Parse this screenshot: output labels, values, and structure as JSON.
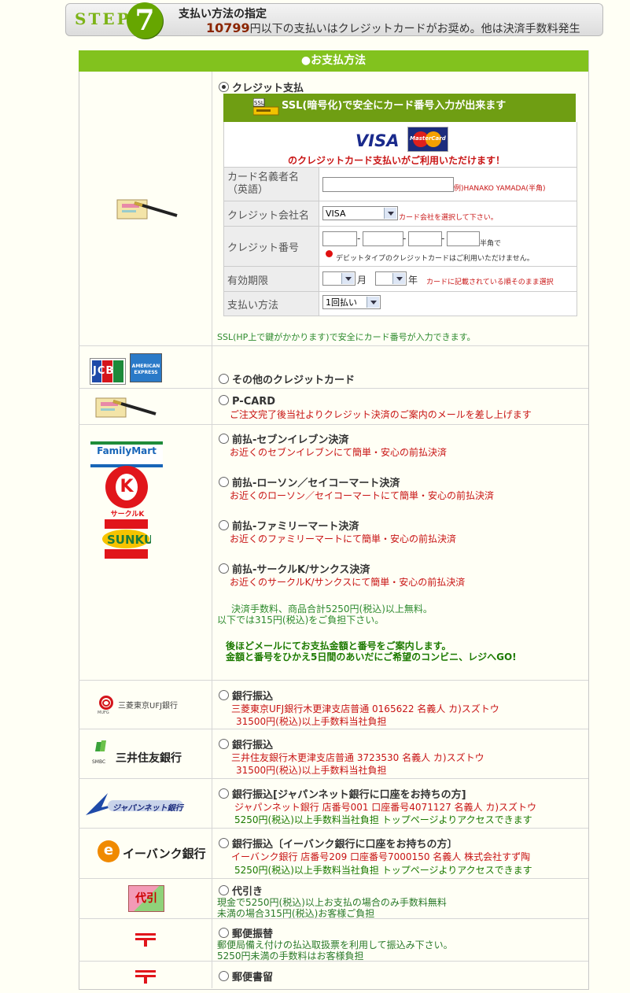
{
  "header": {
    "step_word": "STEP",
    "step_number": "7",
    "title": "支払い方法の指定",
    "threshold_amount": "10799",
    "subtitle": "円以下の支払いはクレジットカードがお奨め。他は決済手数料発生"
  },
  "table": {
    "heading": "●お支払方法"
  },
  "credit": {
    "option_label": "クレジット支払",
    "ssl_banner": "SSL(暗号化)で安全にカード番号入力が出来ます",
    "ssl_icon_text": "SSL",
    "visa_text": "VISA",
    "mastercard_text": "MasterCard",
    "cards_note": "のクレジットカード支払いがご利用いただけます！",
    "form": {
      "holder_label": "カード名義者名（英語）",
      "holder_hint": "例)HANAKO YAMADA(半角)",
      "company_label": "クレジット会社名",
      "company_value": "VISA",
      "company_hint": "カード会社を選択して下さい。",
      "number_label": "クレジット番号",
      "number_hint": "半角で",
      "debit_note": "デビットタイプのクレジットカードはご利用いただけません。",
      "expiry_label": "有効期限",
      "month_unit": "月",
      "year_unit": "年",
      "expiry_hint": "カードに記載されている順そのまま選択",
      "method_label": "支払い方法",
      "method_value": "1回払い"
    },
    "ssl_footer": "SSL(HP上で鍵がかかります)で安全にカード番号が入力できます。"
  },
  "other_credit": {
    "option_label": "その他のクレジットカード",
    "jcb_text": "JCB",
    "amex_text": "AMERICAN EXPRESS"
  },
  "pcard": {
    "option_label": "P-CARD",
    "note": "ご注文完了後当社よりクレジット決済のご案内のメールを差し上げます"
  },
  "convenience": {
    "familymart_logo": "FamilyMart",
    "circlek_logo": "サークルK",
    "options": [
      {
        "label": "前払-セブンイレブン決済",
        "note": "お近くのセブンイレブンにて簡単・安心の前払決済"
      },
      {
        "label": "前払-ローソン／セイコーマート決済",
        "note": "お近くのローソン／セイコーマートにて簡単・安心の前払決済"
      },
      {
        "label": "前払-ファミリーマート決済",
        "note": "お近くのファミリーマートにて簡単・安心の前払決済"
      },
      {
        "label": "前払-サークルK/サンクス決済",
        "note": "お近くのサークルK/サンクスにて簡単・安心の前払決済"
      }
    ],
    "fee_line1": "決済手数料、商品合計5250円(税込)以上無料。",
    "fee_line2": "以下では315円(税込)をご負担下さい。",
    "guide_line1": "後ほどメールにてお支払金額と番号をご案内します。",
    "guide_line2": "金額と番号をひかえ5日間のあいだにご希望のコンビニ、レジへGO!"
  },
  "banks": [
    {
      "logo": "三菱東京UFJ銀行",
      "logo_sub": "MUFG",
      "option_label": "銀行振込",
      "line1": "三菱東京UFJ銀行木更津支店普通  0165622 名義人 カ)スズトウ",
      "line2": "31500円(税込)以上手数料当社負担"
    },
    {
      "logo": "三井住友銀行",
      "logo_sub": "SMBC",
      "option_label": "銀行振込",
      "line1": "三井住友銀行木更津支店普通  3723530 名義人 カ)スズトウ",
      "line2": "31500円(税込)以上手数料当社負担"
    },
    {
      "logo": "ジャパンネット銀行",
      "logo_sub": "",
      "option_label": "銀行振込[ジャパンネット銀行に口座をお持ちの方]",
      "line1": "ジャパンネット銀行  店番号001  口座番号4071127 名義人 カ)スズトウ",
      "line2": "5250円(税込)以上手数料当社負担  トップページよりアクセスできます"
    },
    {
      "logo": "イーバンク銀行",
      "logo_sub": "e",
      "option_label": "銀行振込〔イーバンク銀行に口座をお持ちの方〕",
      "line1": "イーバンク銀行  店番号209  口座番号7000150 名義人 株式会社すず陶",
      "line2": "5250円(税込)以上手数料当社負担  トップページよりアクセスできます"
    }
  ],
  "cod": {
    "icon_text": "代引",
    "option_label": "代引き",
    "line1": "現金で5250円(税込)以上お支払の場合のみ手数料無料",
    "line2": "未満の場合315円(税込)お客様ご負担"
  },
  "postal_transfer": {
    "option_label": "郵便振替",
    "line1": "郵便局備え付けの払込取扱票を利用して振込み下さい。",
    "line2": "5250円未満の手数料はお客様負担"
  },
  "registered_mail": {
    "option_label": "郵便書留"
  },
  "colors": {
    "accent_green": "#82c21e",
    "ssl_green": "#6f9e13",
    "note_red": "#c81414"
  }
}
